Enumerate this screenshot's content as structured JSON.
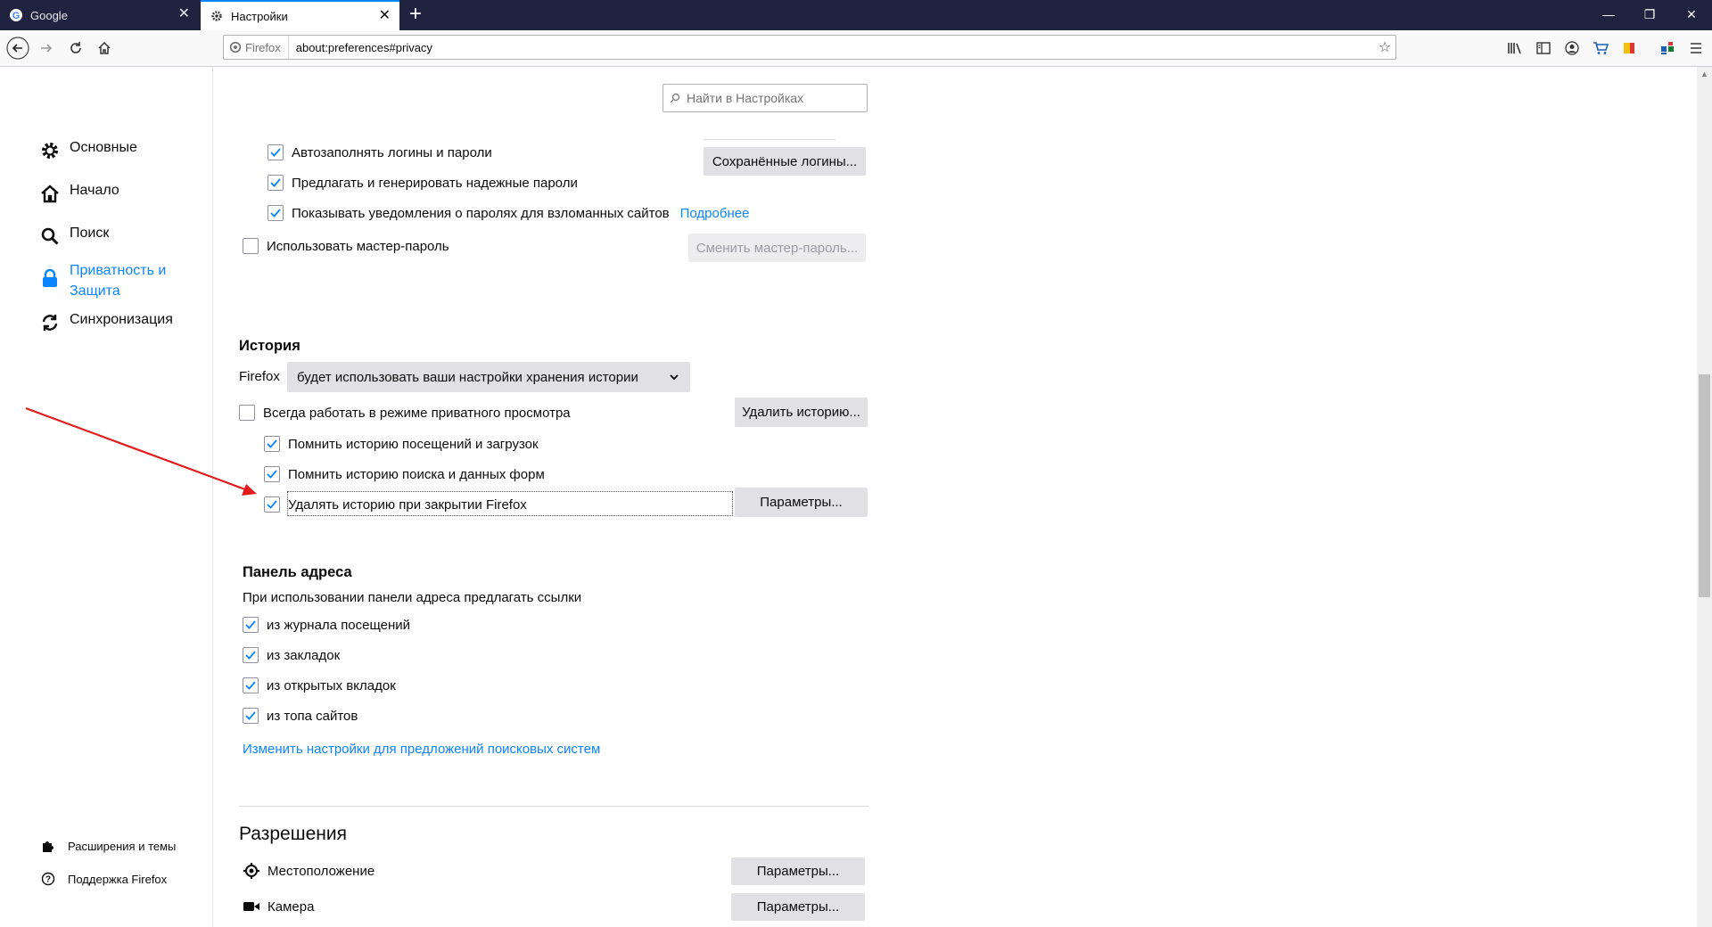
{
  "tabs": [
    {
      "title": "Google",
      "active": false
    },
    {
      "title": "Настройки",
      "active": true
    }
  ],
  "urlbar": {
    "identity": "Firefox",
    "url": "about:preferences#privacy"
  },
  "search": {
    "placeholder": "Найти в Настройках"
  },
  "sidebar": {
    "categories": [
      {
        "label": "Основные",
        "icon": "gear-icon"
      },
      {
        "label": "Начало",
        "icon": "home-icon"
      },
      {
        "label": "Поиск",
        "icon": "search-icon"
      },
      {
        "label": "Приватность и Защита",
        "label_line1": "Приватность и",
        "label_line2": "Защита",
        "icon": "lock-icon",
        "selected": true
      },
      {
        "label": "Синхронизация",
        "icon": "sync-icon"
      }
    ],
    "footer": [
      {
        "label": "Расширения и темы",
        "icon": "puzzle-icon"
      },
      {
        "label": "Поддержка Firefox",
        "icon": "help-icon"
      }
    ]
  },
  "logins": {
    "autofill": {
      "label": "Автозаполнять логины и пароли",
      "checked": true
    },
    "suggest": {
      "label": "Предлагать и генерировать надежные пароли",
      "checked": true
    },
    "breach": {
      "label": "Показывать уведомления о паролях для взломанных сайтов",
      "checked": true,
      "link": "Подробнее"
    },
    "master": {
      "label": "Использовать мастер-пароль",
      "checked": false
    },
    "saved_button": "Сохранённые логины...",
    "change_master_button": "Сменить мастер-пароль..."
  },
  "history": {
    "heading": "История",
    "firefox_label": "Firefox",
    "mode_selected": "будет использовать ваши настройки хранения истории",
    "private_mode": {
      "label": "Всегда работать в режиме приватного просмотра",
      "checked": false
    },
    "remember_visits": {
      "label": "Помнить историю посещений и загрузок",
      "checked": true
    },
    "remember_search": {
      "label": "Помнить историю поиска и данных форм",
      "checked": true
    },
    "clear_on_close": {
      "label": "Удалять историю при закрытии Firefox",
      "checked": true
    },
    "clear_button": "Удалить историю...",
    "settings_button": "Параметры..."
  },
  "address_bar": {
    "heading": "Панель адреса",
    "description": "При использовании панели адреса предлагать ссылки",
    "items": [
      {
        "label": "из журнала посещений",
        "checked": true
      },
      {
        "label": "из закладок",
        "checked": true
      },
      {
        "label": "из открытых вкладок",
        "checked": true
      },
      {
        "label": "из топа сайтов",
        "checked": true
      }
    ],
    "link": "Изменить настройки для предложений поисковых систем"
  },
  "permissions": {
    "heading": "Разрешения",
    "items": [
      {
        "label": "Местоположение",
        "icon": "location-icon",
        "button": "Параметры..."
      },
      {
        "label": "Камера",
        "icon": "camera-icon",
        "button": "Параметры..."
      }
    ]
  },
  "colors": {
    "accent": "#0a84ff",
    "annotation_arrow": "#e31b1b",
    "tabbar": "#202340"
  }
}
